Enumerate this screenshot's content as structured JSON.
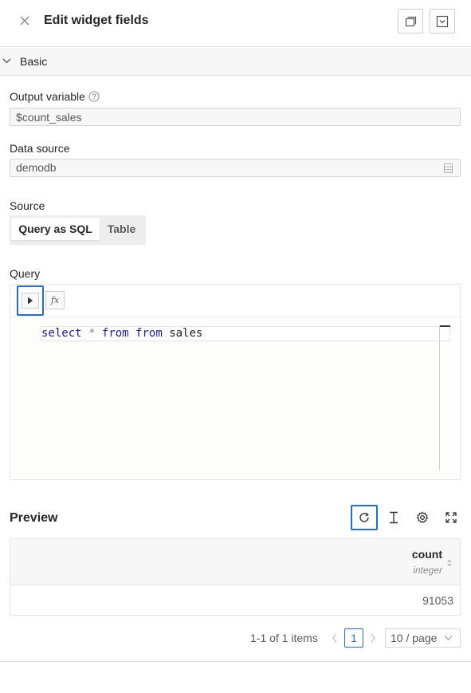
{
  "header": {
    "title": "Edit widget fields",
    "icons": [
      "close-icon",
      "duplicate-icon",
      "collapse-panel-icon"
    ]
  },
  "section": {
    "label": "Basic",
    "expanded": true
  },
  "output_variable": {
    "label": "Output variable",
    "value": "$count_sales"
  },
  "data_source": {
    "label": "Data source",
    "value": "demodb"
  },
  "source": {
    "label": "Source",
    "options": [
      "Query as SQL",
      "Table"
    ],
    "selected": "Query as SQL"
  },
  "query": {
    "label": "Query",
    "fx_label": "fx",
    "tokens": [
      {
        "text": "select",
        "kind": "kw"
      },
      {
        "text": " ",
        "kind": "plain"
      },
      {
        "text": "*",
        "kind": "op"
      },
      {
        "text": " ",
        "kind": "plain"
      },
      {
        "text": "from",
        "kind": "kw"
      },
      {
        "text": " ",
        "kind": "plain"
      },
      {
        "text": "from",
        "kind": "kw"
      },
      {
        "text": " ",
        "kind": "plain"
      },
      {
        "text": "sales",
        "kind": "plain"
      }
    ]
  },
  "preview": {
    "title": "Preview",
    "columns": [
      {
        "name": "count",
        "type": "integer"
      }
    ],
    "rows": [
      [
        "91053"
      ]
    ]
  },
  "pagination": {
    "summary": "1-1 of 1 items",
    "current_page": "1",
    "page_size": "10 / page"
  },
  "colors": {
    "accent": "#1f6fd1",
    "keyword": "#1d1aa8"
  }
}
